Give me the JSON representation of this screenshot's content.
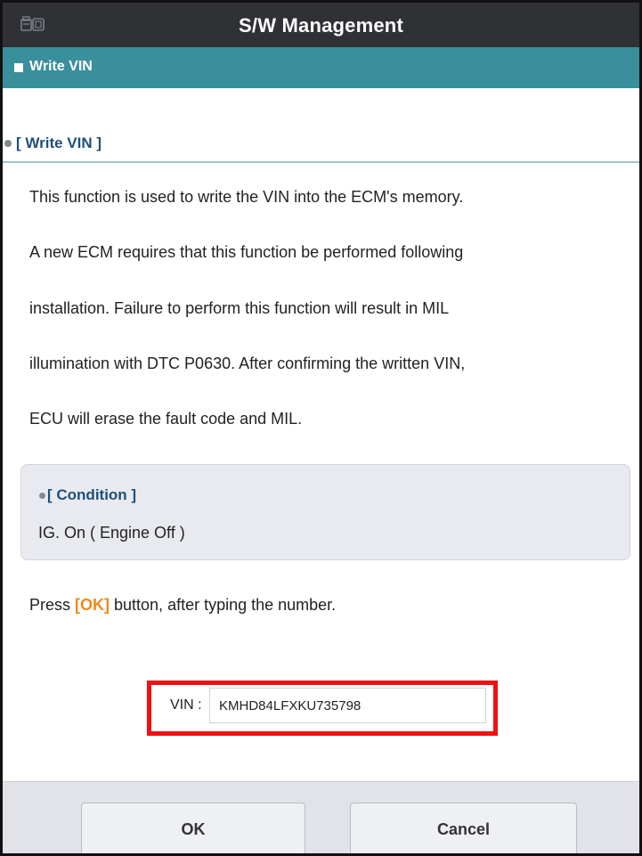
{
  "window": {
    "title": "S/W Management",
    "icon": "car-diagnostic-icon"
  },
  "section": {
    "label": "Write VIN"
  },
  "subheader": {
    "text": "[ Write VIN ]"
  },
  "description": {
    "lines": [
      "This function is used to write the VIN into the ECM's memory.",
      "A new ECM requires that this function be performed following",
      "installation. Failure to perform this function will result in MIL",
      "illumination with DTC P0630. After confirming the written VIN,",
      "ECU will erase the fault code and MIL."
    ]
  },
  "condition": {
    "title": "[ Condition ]",
    "body": "IG. On ( Engine Off )"
  },
  "instruction": {
    "prefix": "Press ",
    "key": "[OK]",
    "suffix": " button, after typing the number."
  },
  "vin": {
    "label": "VIN :",
    "value": "KMHD84LFXKU735798"
  },
  "footer": {
    "ok_label": "OK",
    "cancel_label": "Cancel"
  },
  "colors": {
    "titlebar": "#2f3135",
    "section_bar": "#3a8f9c",
    "ok_key": "#f08a1c",
    "highlight": "#ee1111"
  }
}
